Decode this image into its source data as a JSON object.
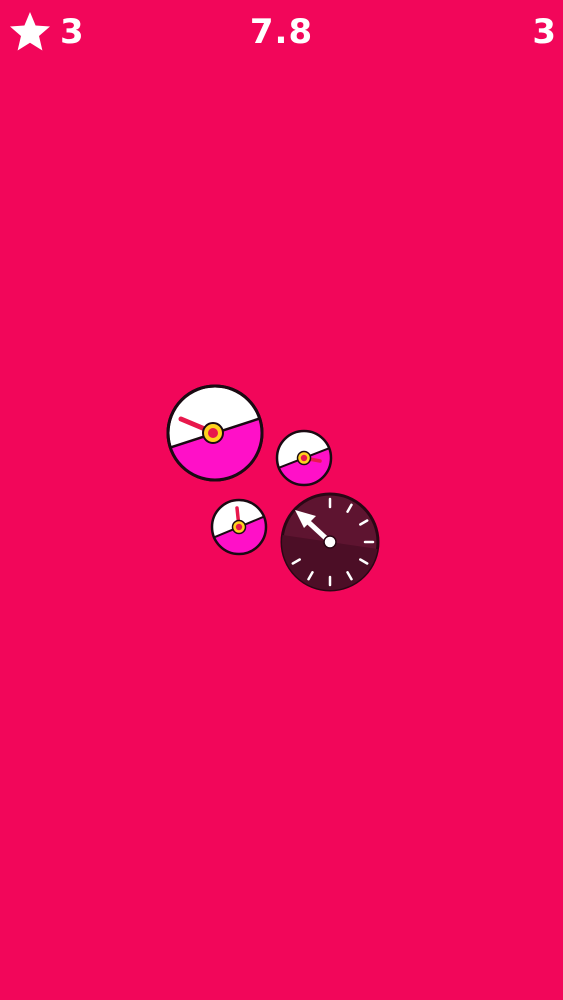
{
  "hud": {
    "stars_icon": "star-icon",
    "stars_count": "3",
    "timer": "7.8",
    "level": "3"
  },
  "colors": {
    "background": "#F2065A",
    "dial_white": "#FFFFFF",
    "dial_magenta": "#FF10C8",
    "dial_outline": "#1A0A12",
    "hub_yellow": "#FFD21E",
    "hub_red": "#E8184C",
    "active_dial_face": "#5E1430",
    "active_hand": "#FFFFFF"
  },
  "dials": [
    {
      "name": "large-dial",
      "hand_angle_deg": -70,
      "fill": "half-magenta"
    },
    {
      "name": "small-dial-right",
      "hand_angle_deg": 100,
      "fill": "half-magenta"
    },
    {
      "name": "small-dial-bottom",
      "hand_angle_deg": -5,
      "fill": "half-magenta"
    },
    {
      "name": "active-dial",
      "hand_angle_deg": -48,
      "fill": "dark-selected"
    }
  ]
}
